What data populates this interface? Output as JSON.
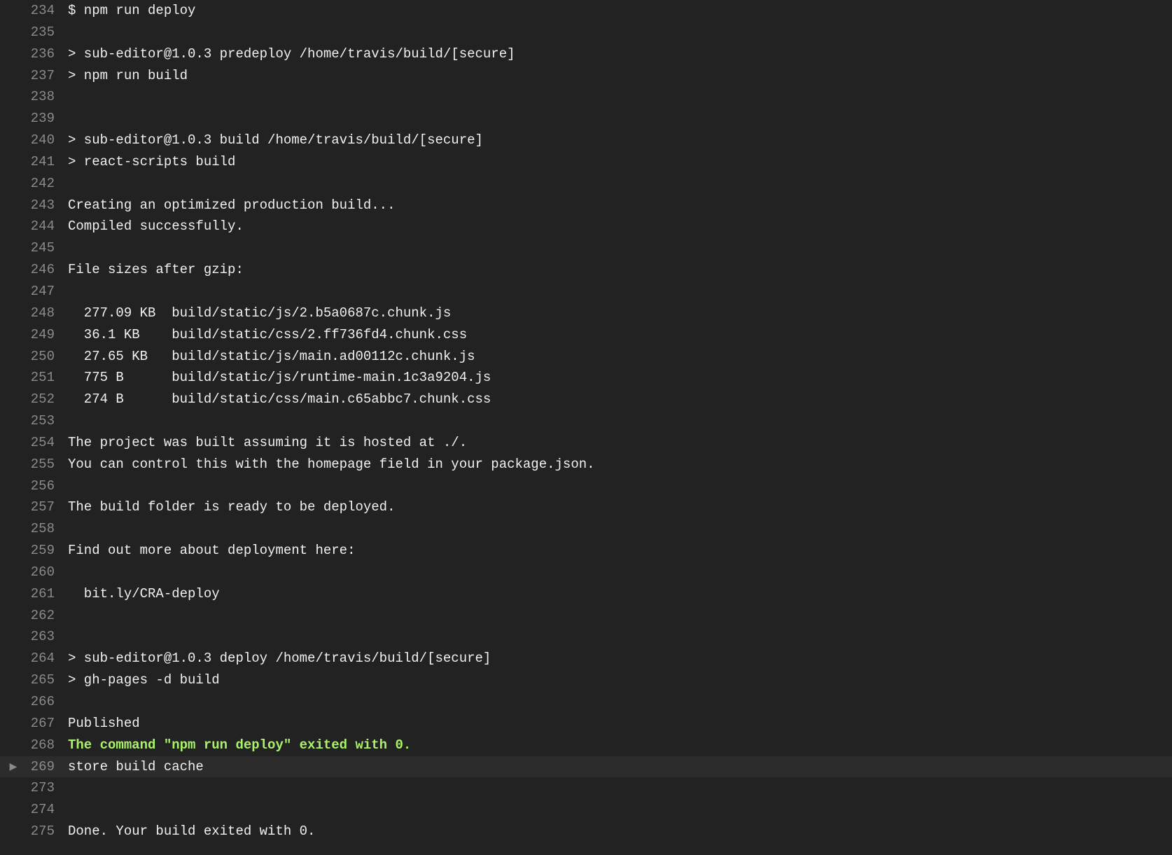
{
  "lines": [
    {
      "n": "234",
      "text": "$ npm run deploy"
    },
    {
      "n": "235",
      "text": ""
    },
    {
      "n": "236",
      "text": "> sub-editor@1.0.3 predeploy /home/travis/build/[secure]"
    },
    {
      "n": "237",
      "text": "> npm run build"
    },
    {
      "n": "238",
      "text": ""
    },
    {
      "n": "239",
      "text": ""
    },
    {
      "n": "240",
      "text": "> sub-editor@1.0.3 build /home/travis/build/[secure]"
    },
    {
      "n": "241",
      "text": "> react-scripts build"
    },
    {
      "n": "242",
      "text": ""
    },
    {
      "n": "243",
      "text": "Creating an optimized production build..."
    },
    {
      "n": "244",
      "text": "Compiled successfully."
    },
    {
      "n": "245",
      "text": ""
    },
    {
      "n": "246",
      "text": "File sizes after gzip:"
    },
    {
      "n": "247",
      "text": ""
    },
    {
      "n": "248",
      "text": "  277.09 KB  build/static/js/2.b5a0687c.chunk.js"
    },
    {
      "n": "249",
      "text": "  36.1 KB    build/static/css/2.ff736fd4.chunk.css"
    },
    {
      "n": "250",
      "text": "  27.65 KB   build/static/js/main.ad00112c.chunk.js"
    },
    {
      "n": "251",
      "text": "  775 B      build/static/js/runtime-main.1c3a9204.js"
    },
    {
      "n": "252",
      "text": "  274 B      build/static/css/main.c65abbc7.chunk.css"
    },
    {
      "n": "253",
      "text": ""
    },
    {
      "n": "254",
      "text": "The project was built assuming it is hosted at ./."
    },
    {
      "n": "255",
      "text": "You can control this with the homepage field in your package.json."
    },
    {
      "n": "256",
      "text": ""
    },
    {
      "n": "257",
      "text": "The build folder is ready to be deployed."
    },
    {
      "n": "258",
      "text": ""
    },
    {
      "n": "259",
      "text": "Find out more about deployment here:"
    },
    {
      "n": "260",
      "text": ""
    },
    {
      "n": "261",
      "text": "  bit.ly/CRA-deploy"
    },
    {
      "n": "262",
      "text": ""
    },
    {
      "n": "263",
      "text": ""
    },
    {
      "n": "264",
      "text": "> sub-editor@1.0.3 deploy /home/travis/build/[secure]"
    },
    {
      "n": "265",
      "text": "> gh-pages -d build"
    },
    {
      "n": "266",
      "text": ""
    },
    {
      "n": "267",
      "text": "Published"
    },
    {
      "n": "268",
      "text": "The command \"npm run deploy\" exited with 0."
    },
    {
      "n": "269",
      "text": "store build cache"
    },
    {
      "n": "273",
      "text": ""
    },
    {
      "n": "274",
      "text": ""
    },
    {
      "n": "275",
      "text": "Done. Your build exited with 0."
    }
  ],
  "fold_toggle_glyph": "▶",
  "colors": {
    "background": "#222222",
    "text": "#f1f1f1",
    "line_number": "#8b8b8b",
    "success": "#a9f26a",
    "fold_row": "#2c2c2c"
  }
}
